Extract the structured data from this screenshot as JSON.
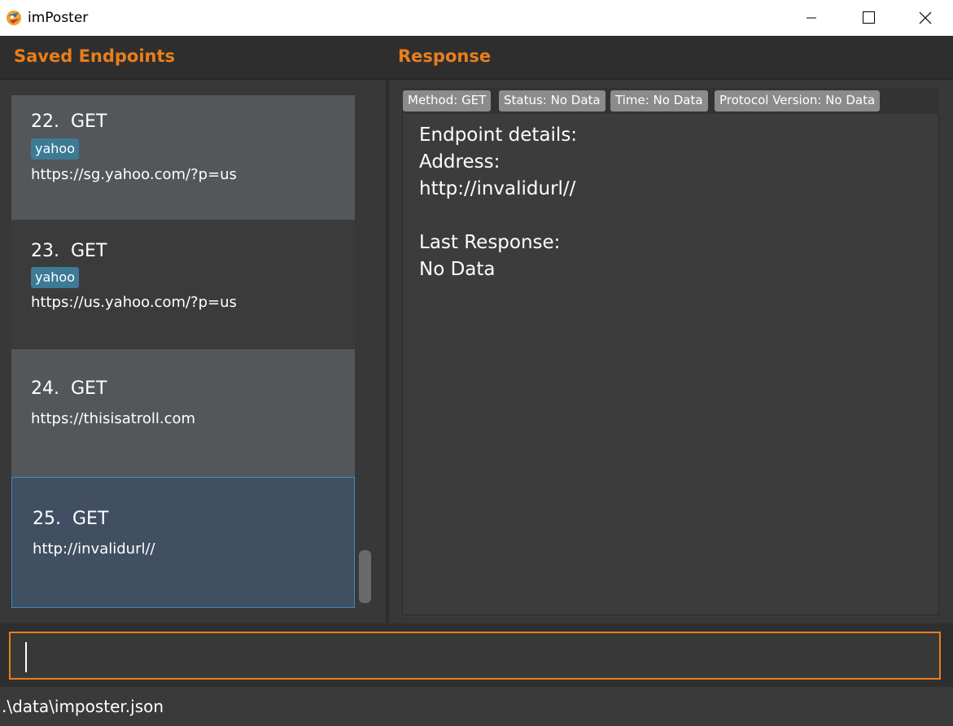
{
  "window": {
    "title": "imPoster",
    "minimize_icon": "minimize-icon",
    "maximize_icon": "maximize-icon",
    "close_icon": "close-icon"
  },
  "headers": {
    "left": "Saved Endpoints",
    "right": "Response"
  },
  "endpoints": [
    {
      "index": "22.",
      "method": "GET",
      "tag": "yahoo",
      "url": "https://sg.yahoo.com/?p=us",
      "bg": "#535759"
    },
    {
      "index": "23.",
      "method": "GET",
      "tag": "yahoo",
      "url": "https://us.yahoo.com/?p=us",
      "bg": "#3b3b3c"
    },
    {
      "index": "24.",
      "method": "GET",
      "tag": "",
      "url": "https://thisisatroll.com",
      "bg": "#535759"
    },
    {
      "index": "25.",
      "method": "GET",
      "tag": "",
      "url": "http://invalidurl//",
      "bg": "#414f62",
      "selected": true
    }
  ],
  "response": {
    "badges": [
      "Method: GET",
      "Status: No Data",
      "Time: No Data",
      "Protocol Version: No Data"
    ],
    "details_lines": [
      "Endpoint details:",
      "Address:",
      "http://invalidurl//",
      "",
      "Last Response:",
      "No Data"
    ]
  },
  "command": {
    "value": "",
    "placeholder": ""
  },
  "status": {
    "path": ".\\data\\imposter.json"
  },
  "colors": {
    "accent": "#e87e1c",
    "tag": "#3c7a96",
    "badge": "#8b8b8b",
    "selected": "#414f62"
  }
}
